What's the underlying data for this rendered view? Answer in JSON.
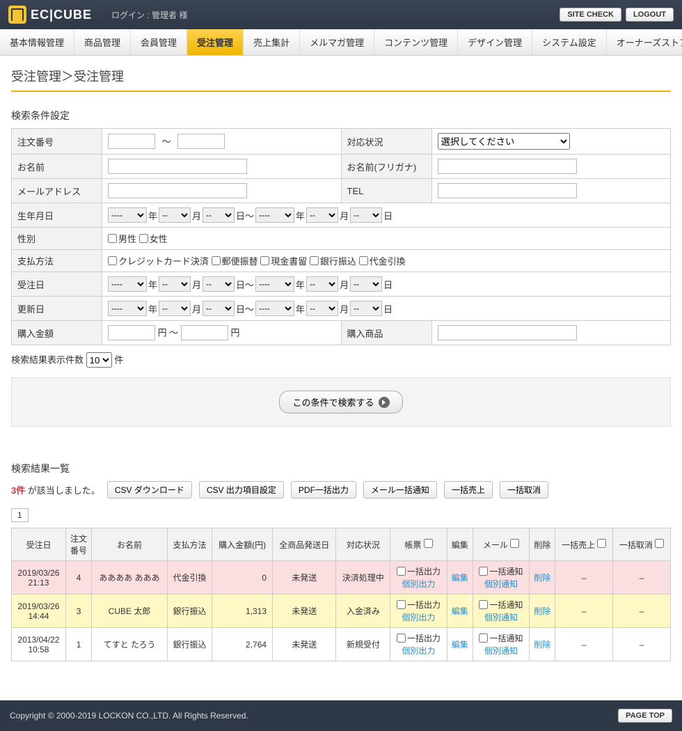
{
  "header": {
    "logo_text": "EC|CUBE",
    "login_info": "ログイン : 管理者 様",
    "site_check": "SITE CHECK",
    "logout": "LOGOUT"
  },
  "tabs": [
    "基本情報管理",
    "商品管理",
    "会員管理",
    "受注管理",
    "売上集計",
    "メルマガ管理",
    "コンテンツ管理",
    "デザイン管理",
    "システム設定",
    "オーナーズストア"
  ],
  "active_tab": 3,
  "breadcrumb": "受注管理＞受注管理",
  "section_search_title": "検索条件設定",
  "labels": {
    "order_no": "注文番号",
    "status": "対応状況",
    "name": "お名前",
    "name_kana": "お名前(フリガナ)",
    "email": "メールアドレス",
    "tel": "TEL",
    "birth": "生年月日",
    "sex": "性別",
    "payment": "支払方法",
    "order_date": "受注日",
    "update_date": "更新日",
    "amount": "購入金額",
    "product": "購入商品",
    "tilde": "～",
    "year": "年",
    "month": "月",
    "day": "日",
    "day_to": "日～",
    "yen": "円",
    "yen_to": "円 ～",
    "male": "男性",
    "female": "女性",
    "pay_credit": "クレジットカード決済",
    "pay_postal": "郵便振替",
    "pay_cash": "現金書留",
    "pay_bank": "銀行振込",
    "pay_cod": "代金引換",
    "status_placeholder": "選択してください",
    "date_dash": "----",
    "date_dd": "--"
  },
  "page_size": {
    "prefix": "検索結果表示件数",
    "value": "10",
    "suffix": "件"
  },
  "search_btn": "この条件で検索する",
  "results": {
    "title": "検索結果一覧",
    "count": "3件",
    "count_suffix": "が該当しました。",
    "csv_dl": "CSV ダウンロード",
    "csv_cfg": "CSV 出力項目設定",
    "pdf": "PDF一括出力",
    "mail": "メール一括通知",
    "bulk_sale": "一括売上",
    "bulk_cancel": "一括取消",
    "page": "1"
  },
  "cols": {
    "date": "受注日",
    "no": "注文\n番号",
    "name": "お名前",
    "payment": "支払方法",
    "amount": "購入金額(円)",
    "ship": "全商品発送日",
    "status": "対応状況",
    "slip": "帳票",
    "edit": "編集",
    "mail": "メール",
    "del": "削除",
    "bulk_sale": "一括売上",
    "bulk_cancel": "一括取消"
  },
  "cell_labels": {
    "bulk_out": "一括出力",
    "indiv_out": "個別出力",
    "bulk_notify": "一括通知",
    "indiv_notify": "個別通知",
    "edit": "編集",
    "del": "削除",
    "dash": "–"
  },
  "rows": [
    {
      "cls": "row-pink",
      "date": "2019/03/26\n21:13",
      "no": "4",
      "name": "ああああ あああ",
      "pay": "代金引換",
      "amount": "0",
      "ship": "未発送",
      "status": "決済処理中"
    },
    {
      "cls": "row-yellow",
      "date": "2019/03/26\n14:44",
      "no": "3",
      "name": "CUBE 太郎",
      "pay": "銀行振込",
      "amount": "1,313",
      "ship": "未発送",
      "status": "入金済み"
    },
    {
      "cls": "",
      "date": "2013/04/22\n10:58",
      "no": "1",
      "name": "てすと たろう",
      "pay": "銀行振込",
      "amount": "2,764",
      "ship": "未発送",
      "status": "新規受付"
    }
  ],
  "footer": {
    "copyright": "Copyright © 2000-2019 LOCKON CO.,LTD. All Rights Reserved.",
    "pagetop": "PAGE TOP"
  }
}
